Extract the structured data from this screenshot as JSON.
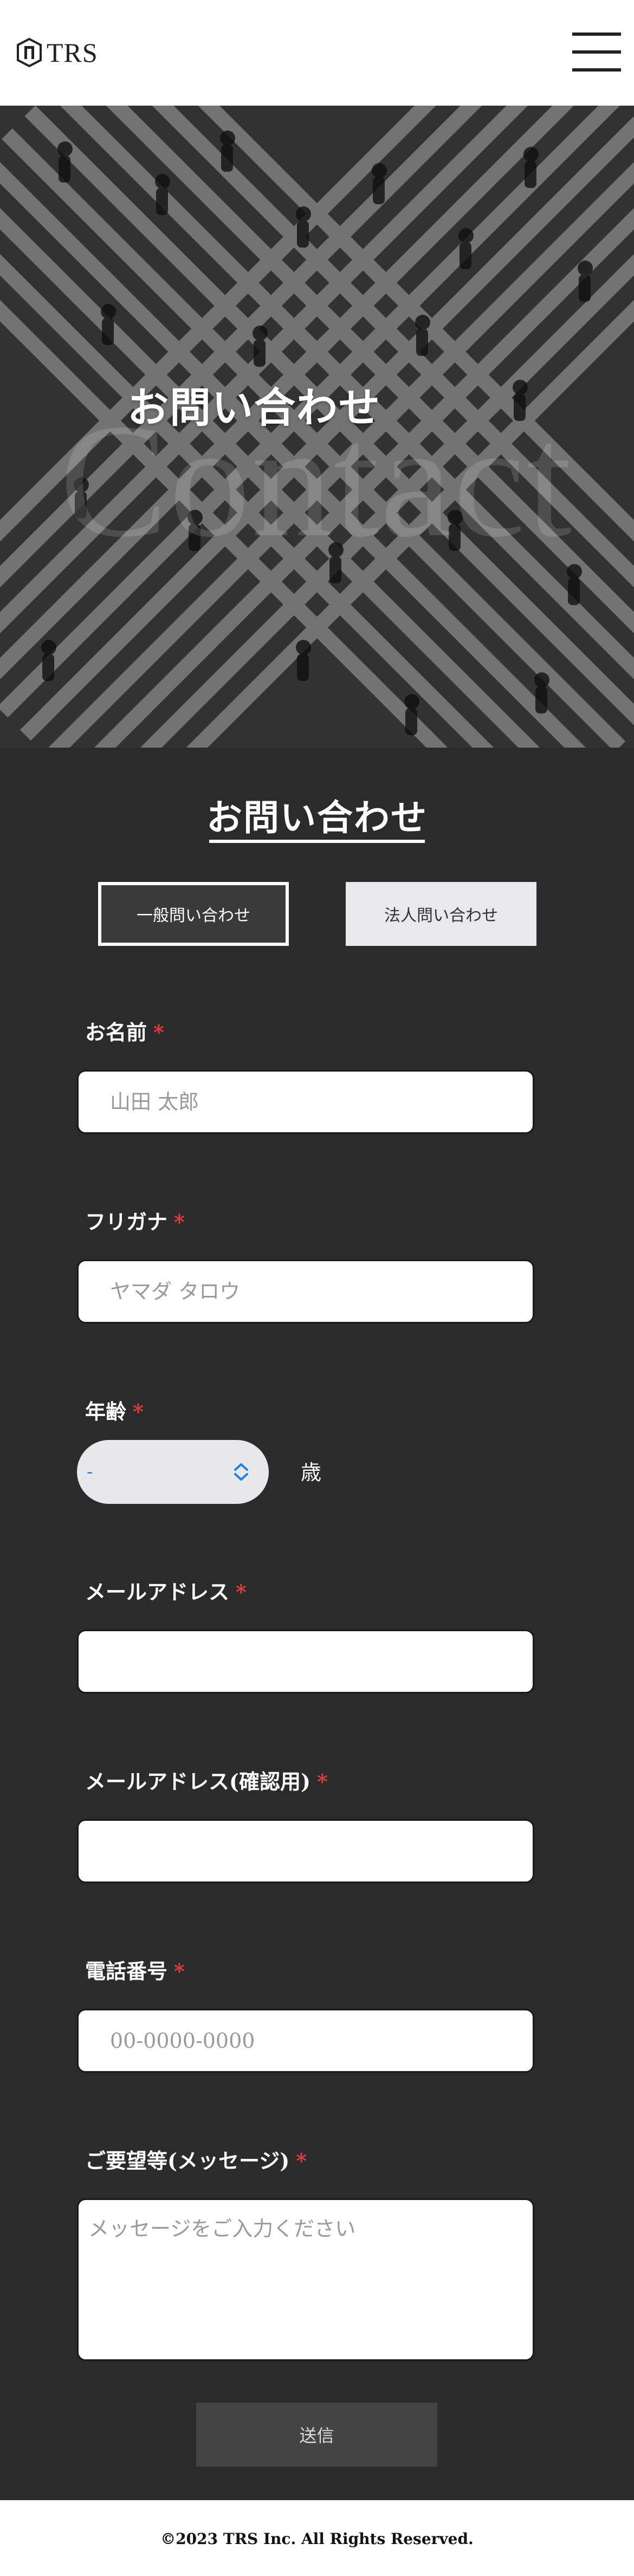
{
  "header": {
    "logo_text": "TRS",
    "menu_icon": "hamburger-icon"
  },
  "hero": {
    "watermark": "Contact",
    "title": "お問い合わせ"
  },
  "form": {
    "section_title": "お問い合わせ",
    "tabs": [
      {
        "label": "一般問い合わせ",
        "active": true
      },
      {
        "label": "法人問い合わせ",
        "active": false
      }
    ],
    "fields": {
      "name": {
        "label": "お名前",
        "required": "*",
        "placeholder": "山田 太郎",
        "value": ""
      },
      "kana": {
        "label": "フリガナ",
        "required": "*",
        "placeholder": "ヤマダ タロウ",
        "value": ""
      },
      "age": {
        "label": "年齢",
        "required": "*",
        "selected": "-",
        "unit": "歳"
      },
      "email": {
        "label": "メールアドレス",
        "required": "*",
        "placeholder": "",
        "value": ""
      },
      "email_confirm": {
        "label": "メールアドレス(確認用)",
        "required": "*",
        "placeholder": "",
        "value": ""
      },
      "phone": {
        "label": "電話番号",
        "required": "*",
        "placeholder": "00-0000-0000",
        "value": ""
      },
      "message": {
        "label": "ご要望等(メッセージ)",
        "required": "*",
        "placeholder": "メッセージをご入力ください",
        "value": ""
      }
    },
    "submit_label": "送信"
  },
  "footer": {
    "copyright": "©2023 TRS Inc. All Rights Reserved."
  },
  "colors": {
    "background": "#2b2b2b",
    "required_mark": "#e23b3b",
    "select_value": "#1a82e8"
  }
}
